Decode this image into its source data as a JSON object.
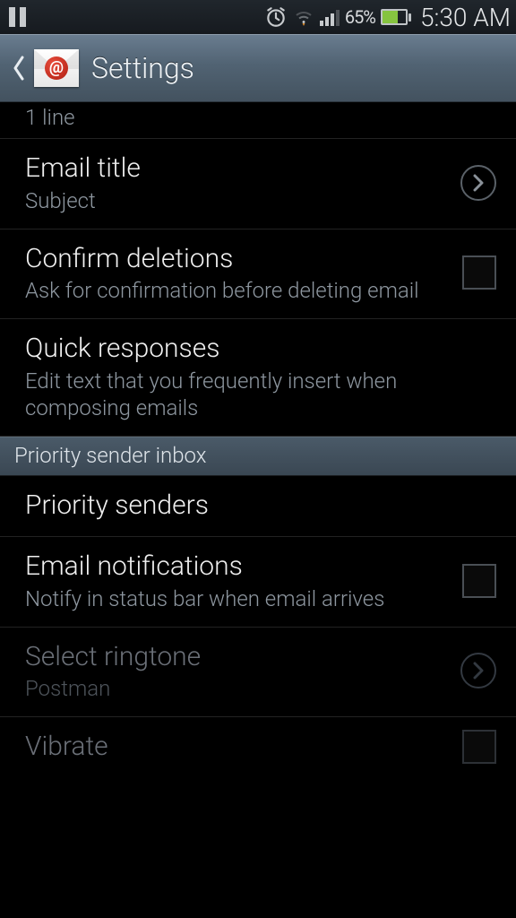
{
  "statusbar": {
    "battery_pct": "65%",
    "time": "5:30 AM"
  },
  "header": {
    "title": "Settings",
    "app_icon_symbol": "@"
  },
  "rows": {
    "partial_prev_sub": "1 line",
    "email_title": {
      "title": "Email title",
      "sub": "Subject"
    },
    "confirm_deletions": {
      "title": "Confirm deletions",
      "sub": "Ask for confirmation before deleting email"
    },
    "quick_responses": {
      "title": "Quick responses",
      "sub": "Edit text that you frequently insert when composing emails"
    },
    "section_priority": "Priority sender inbox",
    "priority_senders": {
      "title": "Priority senders"
    },
    "email_notifications": {
      "title": "Email notifications",
      "sub": "Notify in status bar when email arrives"
    },
    "select_ringtone": {
      "title": "Select ringtone",
      "sub": "Postman"
    },
    "vibrate": {
      "title": "Vibrate"
    }
  }
}
